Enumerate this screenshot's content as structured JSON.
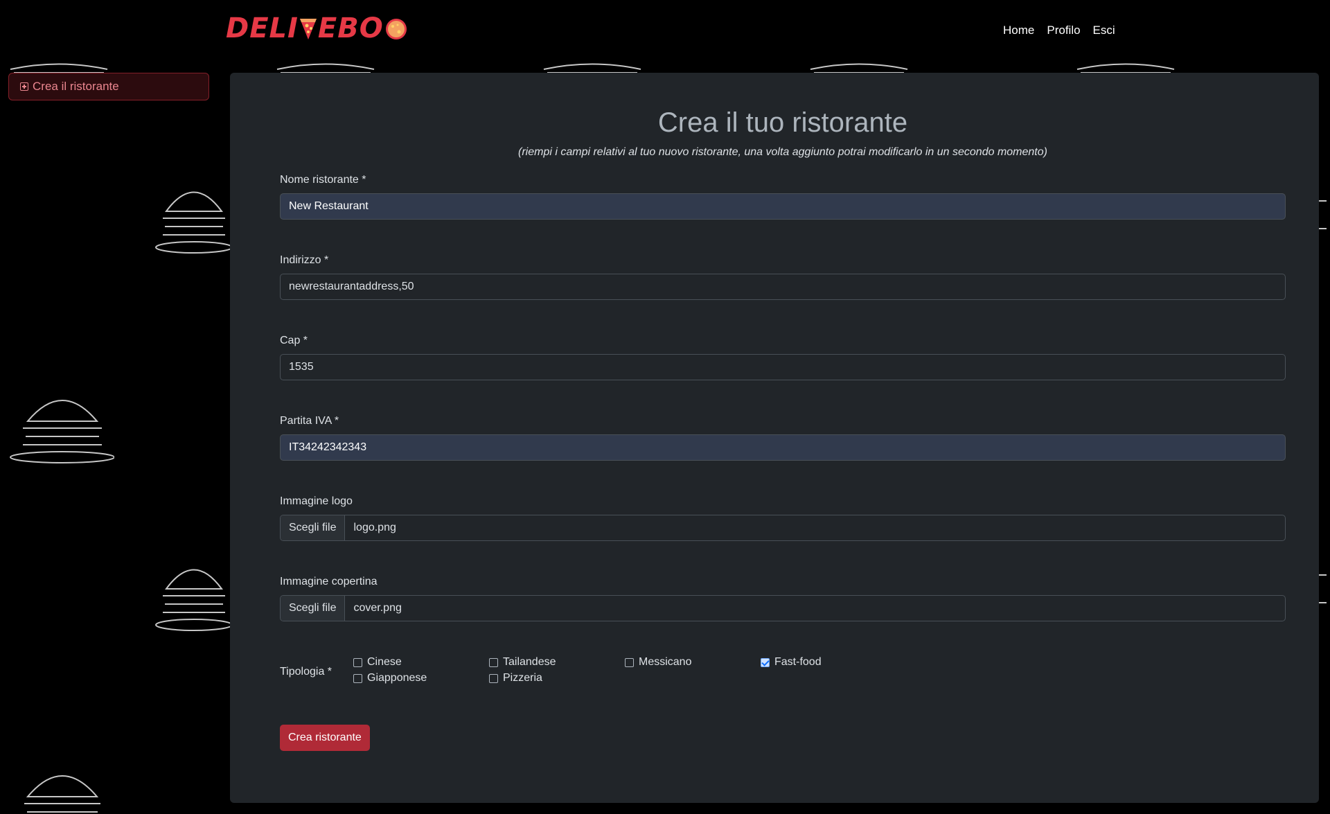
{
  "brand": {
    "logo_text_left": "DELI",
    "logo_text_right": "EBO"
  },
  "nav": {
    "links": [
      "Home",
      "Profilo",
      "Esci"
    ]
  },
  "sidebar": {
    "create_label": "Crea il ristorante"
  },
  "form": {
    "title": "Crea il tuo ristorante",
    "subtitle": "(riempi i campi relativi al tuo nuovo ristorante, una volta aggiunto potrai modificarlo in un secondo momento)",
    "fields": {
      "name": {
        "label": "Nome ristorante *",
        "value": "New Restaurant"
      },
      "address": {
        "label": "Indirizzo *",
        "value": "newrestaurantaddress,50"
      },
      "cap": {
        "label": "Cap *",
        "value": "1535"
      },
      "vat": {
        "label": "Partita IVA *",
        "value": "IT34242342343"
      },
      "logo": {
        "label": "Immagine logo",
        "button": "Scegli file",
        "file": "logo.png"
      },
      "cover": {
        "label": "Immagine copertina",
        "button": "Scegli file",
        "file": "cover.png"
      }
    },
    "tipologia": {
      "label": "Tipologia *",
      "options": [
        {
          "label": "Cinese",
          "checked": false
        },
        {
          "label": "Tailandese",
          "checked": false
        },
        {
          "label": "Messicano",
          "checked": false
        },
        {
          "label": "Fast-food",
          "checked": true
        },
        {
          "label": "Giapponese",
          "checked": false
        },
        {
          "label": "Pizzeria",
          "checked": false
        }
      ]
    },
    "submit_label": "Crea ristorante"
  },
  "colors": {
    "accent": "#b02a37",
    "brand_red": "#e63946",
    "card_bg": "#212529"
  }
}
